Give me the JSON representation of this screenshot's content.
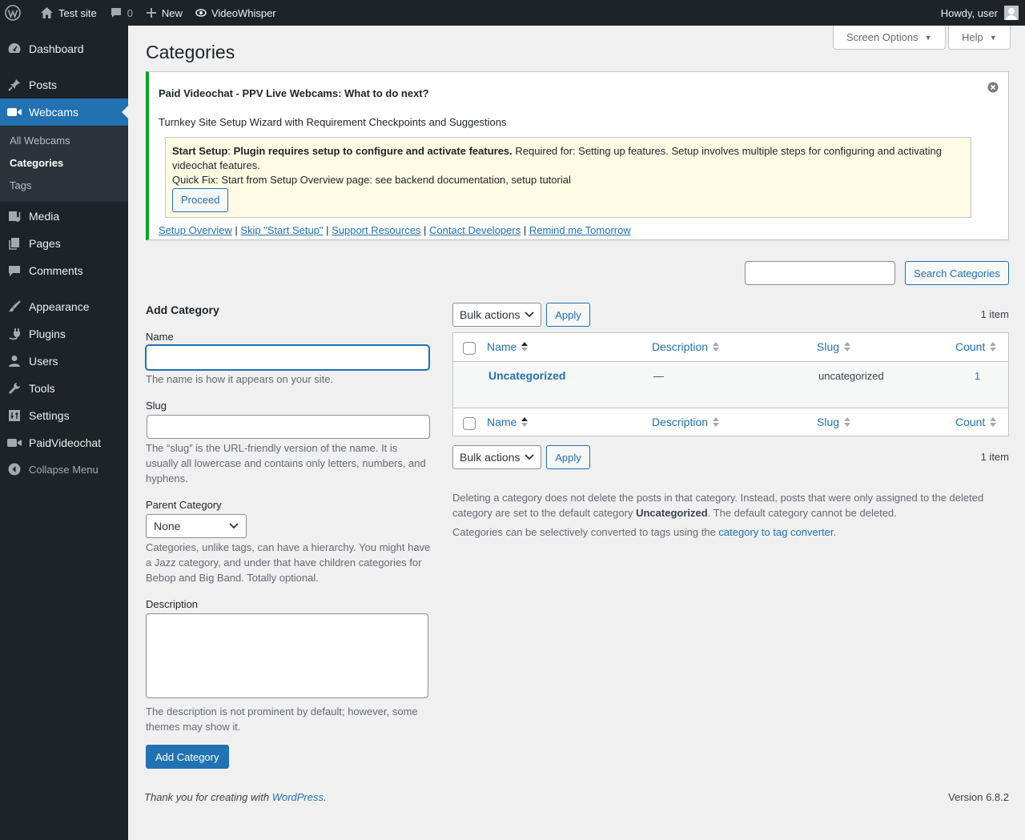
{
  "admin_bar": {
    "site_name": "Test site",
    "comments_count": "0",
    "new_label": "New",
    "plugin_label": "VideoWhisper",
    "howdy": "Howdy, user"
  },
  "sidebar": {
    "items": [
      {
        "label": "Dashboard",
        "icon": "dashboard-icon"
      },
      {
        "label": "Posts",
        "icon": "pin-icon"
      },
      {
        "label": "Webcams",
        "icon": "video-camera-icon"
      },
      {
        "label": "Media",
        "icon": "media-icon"
      },
      {
        "label": "Pages",
        "icon": "pages-icon"
      },
      {
        "label": "Comments",
        "icon": "comment-icon"
      },
      {
        "label": "Appearance",
        "icon": "brush-icon"
      },
      {
        "label": "Plugins",
        "icon": "plug-icon"
      },
      {
        "label": "Users",
        "icon": "user-icon"
      },
      {
        "label": "Tools",
        "icon": "wrench-icon"
      },
      {
        "label": "Settings",
        "icon": "settings-icon"
      },
      {
        "label": "PaidVideochat",
        "icon": "video-camera-icon"
      }
    ],
    "submenu": [
      "All Webcams",
      "Categories",
      "Tags"
    ],
    "collapse_label": "Collapse Menu"
  },
  "header": {
    "screen_options": "Screen Options",
    "help": "Help",
    "title": "Categories"
  },
  "notice": {
    "title": "Paid Videochat - PPV Live Webcams: What to do next?",
    "subtitle": "Turnkey Site Setup Wizard with Requirement Checkpoints and Suggestions",
    "setup_label": "Start Setup",
    "setup_bold": "Plugin requires setup to configure and activate features.",
    "setup_text": " Required for: Setting up features. Setup involves multiple steps for configuring and activating videochat features.",
    "quick_fix": "Quick Fix: Start from Setup Overview page: see backend documentation, setup tutorial",
    "proceed": "Proceed",
    "links": [
      "Setup Overview",
      "Skip \"Start Setup\"",
      "Support Resources",
      "Contact Developers",
      "Remind me Tomorrow"
    ]
  },
  "search": {
    "button": "Search Categories"
  },
  "form": {
    "heading": "Add Category",
    "name_label": "Name",
    "name_help": "The name is how it appears on your site.",
    "slug_label": "Slug",
    "slug_help": "The “slug” is the URL-friendly version of the name. It is usually all lowercase and contains only letters, numbers, and hyphens.",
    "parent_label": "Parent Category",
    "parent_value": "None",
    "parent_help": "Categories, unlike tags, can have a hierarchy. You might have a Jazz category, and under that have children categories for Bebop and Big Band. Totally optional.",
    "description_label": "Description",
    "description_help": "The description is not prominent by default; however, some themes may show it.",
    "submit": "Add Category"
  },
  "table": {
    "bulk_actions": "Bulk actions",
    "apply": "Apply",
    "items_count": "1 item",
    "columns": [
      "Name",
      "Description",
      "Slug",
      "Count"
    ],
    "rows": [
      {
        "name": "Uncategorized",
        "description": "—",
        "slug": "uncategorized",
        "count": "1"
      }
    ]
  },
  "info": {
    "delete_text_1": "Deleting a category does not delete the posts in that category. Instead, posts that were only assigned to the deleted category are set to the default category ",
    "delete_bold": "Uncategorized",
    "delete_text_2": ". The default category cannot be deleted.",
    "convert_text": "Categories can be selectively converted to tags using the ",
    "convert_link": "category to tag converter",
    "convert_end": "."
  },
  "footer": {
    "thanks_prefix": "Thank you for creating with ",
    "thanks_link": "WordPress",
    "thanks_suffix": ".",
    "version": "Version 6.8.2"
  },
  "colors": {
    "admin_dark": "#1d2327",
    "accent": "#2271b1",
    "notice_success": "#00a32a",
    "setup_bg": "#fffbe5"
  }
}
